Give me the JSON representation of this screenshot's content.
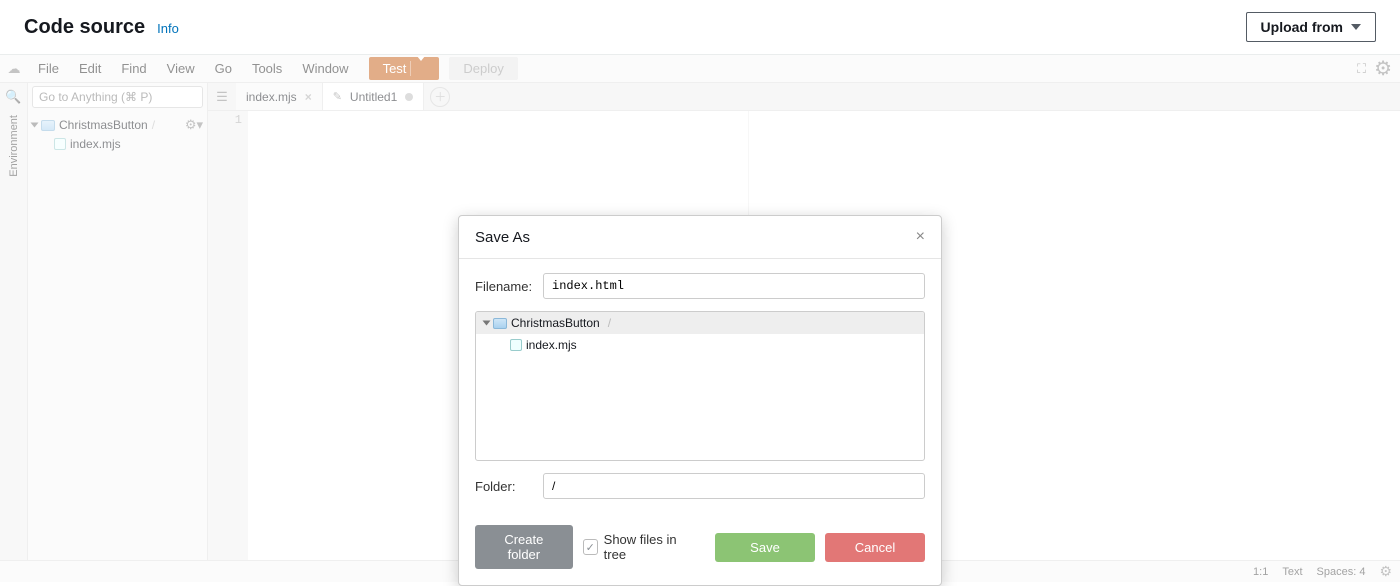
{
  "header": {
    "title": "Code source",
    "info": "Info",
    "upload": "Upload from"
  },
  "menubar": {
    "items": [
      "File",
      "Edit",
      "Find",
      "View",
      "Go",
      "Tools",
      "Window"
    ],
    "test": "Test",
    "deploy": "Deploy"
  },
  "sidebar": {
    "env_label": "Environment",
    "search_placeholder": "Go to Anything (⌘ P)",
    "root": "ChristmasButton",
    "file": "index.mjs"
  },
  "tabs": {
    "t1": "index.mjs",
    "t2": "Untitled1"
  },
  "editor": {
    "line1": "1"
  },
  "status": {
    "pos": "1:1",
    "lang": "Text",
    "spaces": "Spaces: 4"
  },
  "modal": {
    "title": "Save As",
    "filename_label": "Filename:",
    "filename_value": "index.html",
    "tree_root": "ChristmasButton",
    "tree_file": "index.mjs",
    "folder_label": "Folder:",
    "folder_value": "/",
    "create_folder": "Create folder",
    "show_files": "Show files in tree",
    "save": "Save",
    "cancel": "Cancel"
  }
}
